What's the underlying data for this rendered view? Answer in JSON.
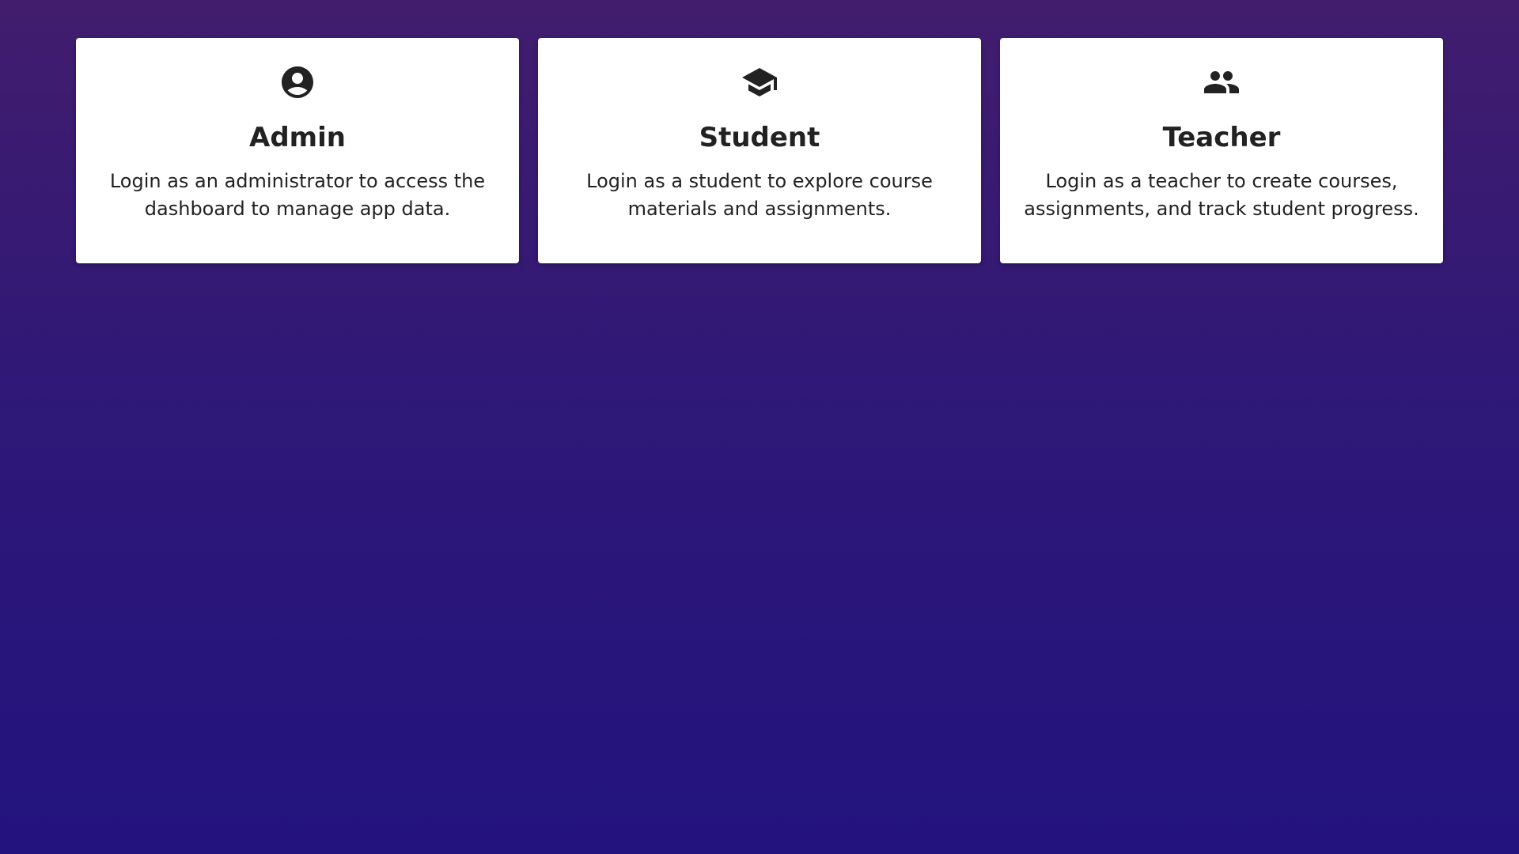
{
  "roles": [
    {
      "icon": "account-circle-icon",
      "title": "Admin",
      "description": "Login as an administrator to access the dashboard to manage app data."
    },
    {
      "icon": "graduation-cap-icon",
      "title": "Student",
      "description": "Login as a student to explore course materials and assignments."
    },
    {
      "icon": "group-icon",
      "title": "Teacher",
      "description": "Login as a teacher to create courses, assignments, and track student progress."
    }
  ],
  "colors": {
    "background_top": "#421d6e",
    "background_bottom": "#23137f",
    "card": "#ffffff",
    "text": "#222222"
  }
}
